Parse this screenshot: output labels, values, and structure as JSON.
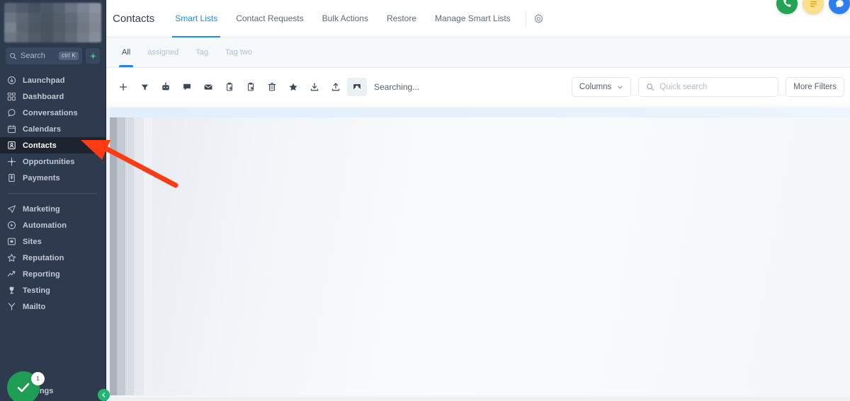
{
  "sidebar": {
    "search": {
      "placeholder": "Search",
      "shortcut": "ctrl K",
      "ai_icon": "sparkle-icon"
    },
    "items": [
      {
        "label": "Launchpad",
        "icon": "rocket-icon",
        "active": false
      },
      {
        "label": "Dashboard",
        "icon": "grid-icon",
        "active": false
      },
      {
        "label": "Conversations",
        "icon": "chat-bubble-icon",
        "active": false
      },
      {
        "label": "Calendars",
        "icon": "calendar-icon",
        "active": false
      },
      {
        "label": "Contacts",
        "icon": "contact-card-icon",
        "active": true
      },
      {
        "label": "Opportunities",
        "icon": "nodes-icon",
        "active": false
      },
      {
        "label": "Payments",
        "icon": "receipt-icon",
        "active": false
      }
    ],
    "items_secondary": [
      {
        "label": "Marketing",
        "icon": "paper-plane-icon",
        "active": false
      },
      {
        "label": "Automation",
        "icon": "play-circle-icon",
        "active": false
      },
      {
        "label": "Sites",
        "icon": "browser-icon",
        "active": false
      },
      {
        "label": "Reputation",
        "icon": "star-outline-icon",
        "active": false
      },
      {
        "label": "Reporting",
        "icon": "trend-up-icon",
        "active": false
      },
      {
        "label": "Testing",
        "icon": "trophy-icon",
        "active": false
      },
      {
        "label": "Mailto",
        "icon": "y-funnel-icon",
        "active": false
      }
    ],
    "settings": {
      "label": "Settings",
      "badge_count": "1",
      "check_icon": "check-circle-icon"
    },
    "collapse": {
      "icon": "chevron-left-icon"
    }
  },
  "header": {
    "title": "Contacts",
    "tabs": [
      {
        "label": "Smart Lists",
        "active": true
      },
      {
        "label": "Contact Requests",
        "active": false
      },
      {
        "label": "Bulk Actions",
        "active": false
      },
      {
        "label": "Restore",
        "active": false
      },
      {
        "label": "Manage Smart Lists",
        "active": false
      }
    ],
    "gear_icon": "gear-icon"
  },
  "subtabs": [
    {
      "label": "All",
      "active": true
    },
    {
      "label": "assigned",
      "active": false
    },
    {
      "label": "Tag",
      "active": false
    },
    {
      "label": "Tag two",
      "active": false
    }
  ],
  "toolbar": {
    "icons": [
      {
        "name": "add-icon",
        "glyph": "+",
        "selected": false
      },
      {
        "name": "filter-icon",
        "glyph": "▼",
        "selected": false
      },
      {
        "name": "bot-icon",
        "glyph": "",
        "selected": false
      },
      {
        "name": "sms-icon",
        "glyph": "",
        "selected": false
      },
      {
        "name": "email-icon",
        "glyph": "",
        "selected": false
      },
      {
        "name": "add-to-list-icon",
        "glyph": "",
        "selected": false
      },
      {
        "name": "remove-from-list-icon",
        "glyph": "",
        "selected": false
      },
      {
        "name": "delete-icon",
        "glyph": "",
        "selected": false
      },
      {
        "name": "favorite-icon",
        "glyph": "★",
        "selected": false
      },
      {
        "name": "import-icon",
        "glyph": "",
        "selected": false
      },
      {
        "name": "export-icon",
        "glyph": "",
        "selected": false
      },
      {
        "name": "merge-icon",
        "glyph": "",
        "selected": true
      }
    ],
    "status_text": "Searching...",
    "columns_label": "Columns",
    "columns_chevron": "chevron-down-icon",
    "quick_search_placeholder": "Quick search",
    "quick_search_value": "",
    "more_filters_label": "More Filters"
  },
  "floating_actions": [
    {
      "name": "call-widget-icon",
      "color": "#23a455"
    },
    {
      "name": "notes-widget-icon",
      "color": "#fbe08a"
    },
    {
      "name": "chat-widget-icon",
      "color": "#2d7ff0"
    }
  ],
  "annotation": {
    "type": "arrow",
    "color": "#ff3b16",
    "points_to": "sidebar-item-contacts"
  },
  "colors": {
    "sidebar_bg": "#2e3a4e",
    "sidebar_active_bg": "#1d242f",
    "accent_blue": "#2684e8",
    "tab_active": "#1f8ceb",
    "annotation_red": "#ff3b16",
    "green": "#1f9d55"
  }
}
